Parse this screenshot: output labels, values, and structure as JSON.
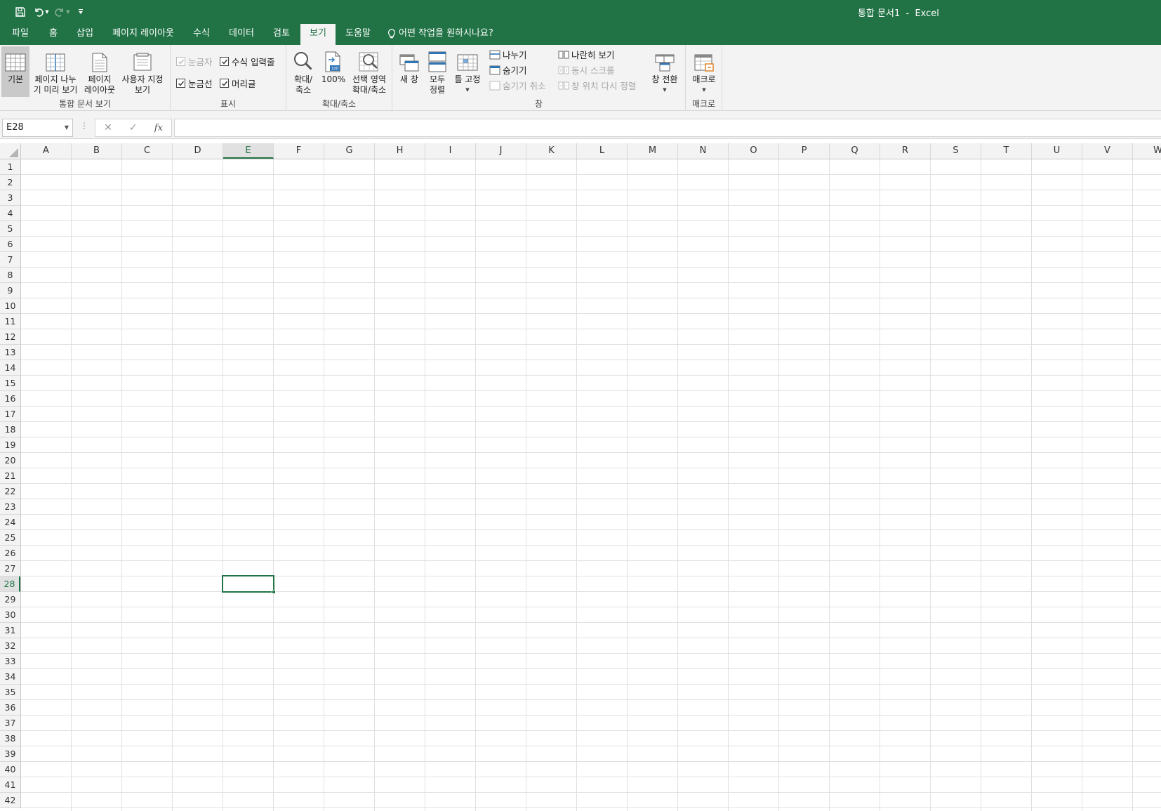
{
  "window": {
    "title": "통합 문서1  -  Excel"
  },
  "tabs": [
    {
      "label": "파일",
      "active": false
    },
    {
      "label": "홈",
      "active": false
    },
    {
      "label": "삽입",
      "active": false
    },
    {
      "label": "페이지 레이아웃",
      "active": false
    },
    {
      "label": "수식",
      "active": false
    },
    {
      "label": "데이터",
      "active": false
    },
    {
      "label": "검토",
      "active": false
    },
    {
      "label": "보기",
      "active": true
    },
    {
      "label": "도움말",
      "active": false
    }
  ],
  "tellme": "어떤 작업을 원하시나요?",
  "ribbon": {
    "workbook_views": {
      "label": "통합 문서 보기",
      "normal": "기본",
      "page_break_1": "페이지 나누",
      "page_break_2": "기 미리 보기",
      "page_layout_1": "페이지",
      "page_layout_2": "레이아웃",
      "custom_1": "사용자 지정",
      "custom_2": "보기"
    },
    "show": {
      "label": "표시",
      "ruler": "눈금자",
      "formula_bar": "수식 입력줄",
      "gridlines": "눈금선",
      "headings": "머리글"
    },
    "zoom": {
      "label": "확대/축소",
      "zoom_1": "확대/",
      "zoom_2": "축소",
      "hundred": "100%",
      "selection_1": "선택 영역",
      "selection_2": "확대/축소"
    },
    "window": {
      "label": "창",
      "new_window": "새 창",
      "arrange_1": "모두",
      "arrange_2": "정렬",
      "freeze": "틀 고정",
      "split": "나누기",
      "hide": "숨기기",
      "unhide": "숨기기 취소",
      "side_by_side": "나란히 보기",
      "sync_scroll": "동시 스크롤",
      "reset_position": "창 위치 다시 정렬",
      "switch": "창 전환"
    },
    "macros": {
      "label": "매크로",
      "macros": "매크로"
    }
  },
  "formula_bar": {
    "name_box": "E28",
    "formula": ""
  },
  "sheet": {
    "columns": [
      "A",
      "B",
      "C",
      "D",
      "E",
      "F",
      "G",
      "H",
      "I",
      "J",
      "K",
      "L",
      "M",
      "N",
      "O",
      "P",
      "Q",
      "R",
      "S",
      "T",
      "U",
      "V",
      "W"
    ],
    "rows": [
      "1",
      "2",
      "3",
      "4",
      "5",
      "6",
      "7",
      "8",
      "9",
      "10",
      "11",
      "12",
      "13",
      "14",
      "15",
      "16",
      "17",
      "18",
      "19",
      "20",
      "21",
      "22",
      "23",
      "24",
      "25",
      "26",
      "27",
      "28",
      "29",
      "30",
      "31",
      "32",
      "33",
      "34",
      "35",
      "36",
      "37",
      "38",
      "39",
      "40",
      "41",
      "42"
    ],
    "active_col": "E",
    "active_row": "28"
  }
}
